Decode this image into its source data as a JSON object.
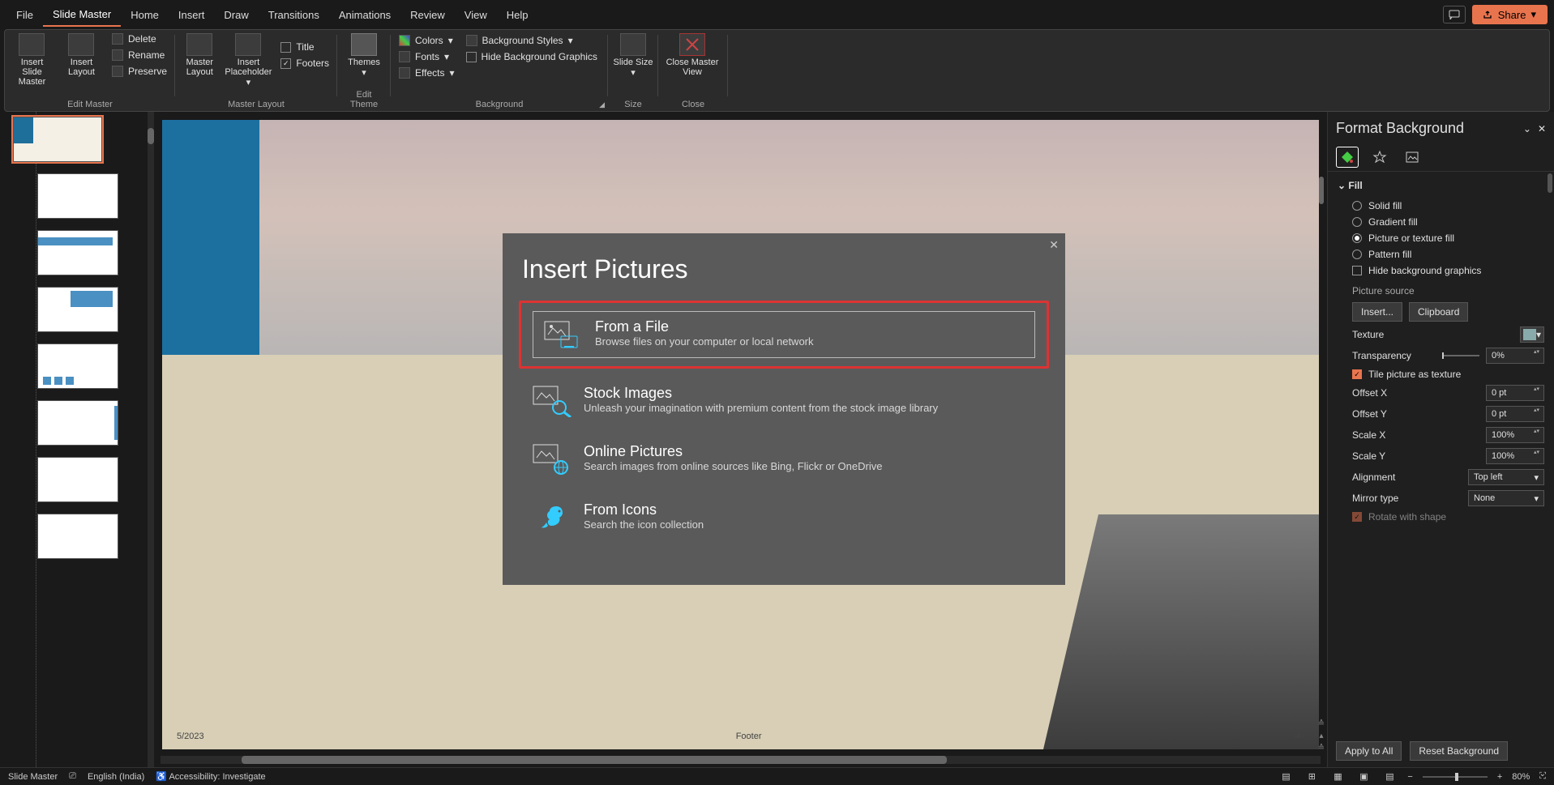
{
  "tabs": [
    "File",
    "Slide Master",
    "Home",
    "Insert",
    "Draw",
    "Transitions",
    "Animations",
    "Review",
    "View",
    "Help"
  ],
  "active_tab": "Slide Master",
  "share": "Share",
  "ribbon": {
    "groups": {
      "edit_master": {
        "label": "Edit Master",
        "insert_slide_master": "Insert Slide Master",
        "insert_layout": "Insert Layout",
        "delete": "Delete",
        "rename": "Rename",
        "preserve": "Preserve"
      },
      "master_layout": {
        "label": "Master Layout",
        "master_layout_btn": "Master Layout",
        "insert_placeholder": "Insert Placeholder",
        "title": "Title",
        "footers": "Footers"
      },
      "edit_theme": {
        "label": "Edit Theme",
        "themes": "Themes"
      },
      "background": {
        "label": "Background",
        "colors": "Colors",
        "fonts": "Fonts",
        "effects": "Effects",
        "bg_styles": "Background Styles",
        "hide_bg": "Hide Background Graphics"
      },
      "size": {
        "label": "Size",
        "slide_size": "Slide Size"
      },
      "close": {
        "label": "Close",
        "close_master": "Close Master View"
      }
    }
  },
  "dialog": {
    "title": "Insert Pictures",
    "options": [
      {
        "title": "From a File",
        "desc": "Browse files on your computer or local network"
      },
      {
        "title": "Stock Images",
        "desc": "Unleash your imagination with premium content from the stock image library"
      },
      {
        "title": "Online Pictures",
        "desc": "Search images from online sources like Bing, Flickr or OneDrive"
      },
      {
        "title": "From Icons",
        "desc": "Search the icon collection"
      }
    ]
  },
  "slide": {
    "date": "5/2023",
    "footer": "Footer",
    "num": "‹#›"
  },
  "pane": {
    "title": "Format Background",
    "fill": "Fill",
    "solid": "Solid fill",
    "gradient": "Gradient fill",
    "picture": "Picture or texture fill",
    "pattern": "Pattern fill",
    "hide": "Hide background graphics",
    "picture_source": "Picture source",
    "insert": "Insert...",
    "clipboard": "Clipboard",
    "texture": "Texture",
    "transparency": "Transparency",
    "transparency_val": "0%",
    "tile": "Tile picture as texture",
    "offset_x": "Offset X",
    "offset_x_v": "0 pt",
    "offset_y": "Offset Y",
    "offset_y_v": "0 pt",
    "scale_x": "Scale X",
    "scale_x_v": "100%",
    "scale_y": "Scale Y",
    "scale_y_v": "100%",
    "alignment": "Alignment",
    "alignment_v": "Top left",
    "mirror": "Mirror type",
    "mirror_v": "None",
    "rotate": "Rotate with shape",
    "apply": "Apply to All",
    "reset": "Reset Background"
  },
  "status": {
    "mode": "Slide Master",
    "lang": "English (India)",
    "acc": "Accessibility: Investigate",
    "zoom": "80%"
  }
}
